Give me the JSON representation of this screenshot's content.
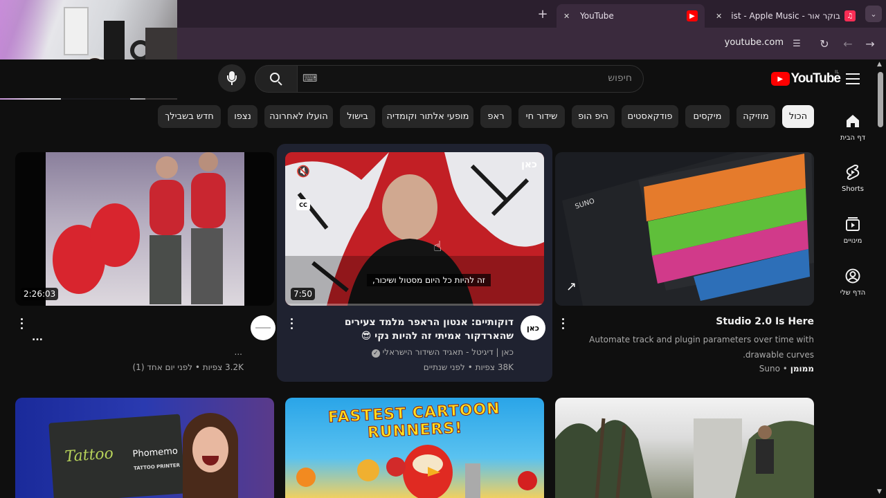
{
  "browser": {
    "tabs": [
      {
        "title": "YouTube"
      },
      {
        "title": "בוקר אור - Playlist - Apple Music"
      }
    ],
    "new_tab": "+",
    "url": "youtube.com"
  },
  "youtube": {
    "logo_text": "YouTube",
    "region": "IL",
    "search_placeholder": "חיפוש",
    "keyboard_glyph": "⌨"
  },
  "chips": [
    "הכול",
    "מוזיקה",
    "מיקסים",
    "פודקאסטים",
    "היפ הופ",
    "שידור חי",
    "ראפ",
    "מופעי אלתור וקומדיה",
    "בישול",
    "הועלו לאחרונה",
    "נצפו",
    "חדש בשבילך"
  ],
  "sidebar": [
    {
      "label": "דף הבית",
      "icon": "home-icon"
    },
    {
      "label": "Shorts",
      "icon": "shorts-icon"
    },
    {
      "label": "מינויים",
      "icon": "subscriptions-icon"
    },
    {
      "label": "הדף שלי",
      "icon": "account-icon"
    }
  ],
  "videos": [
    {
      "title": "Studio 2.0 Is Here",
      "description": "Automate track and plugin parameters over time with drawable curves.",
      "sponsored": "ממומן",
      "channel": "Suno",
      "bullet": "•"
    },
    {
      "title": "דוקותיים: אנטון הראפר מלמד צעירים שהארדקור אמיתי זה להיות נקי 😎",
      "channel": "כאן | דיגיטל - תאגיד השידור הישראלי",
      "meta": "38K צפיות • לפני שנתיים",
      "duration": "7:50",
      "caption": "זה להיות כל היום מסטול ושיכור,",
      "cc": "CC",
      "kan_logo": "כאן",
      "avatar_text": "כאן"
    },
    {
      "title": "...",
      "subtitle": "...",
      "meta": "3.2K צפיות • לפני יום אחד (1)",
      "duration": "2:26:03"
    }
  ],
  "row2": [
    {
      "banner": "FASTEST CARTOON RUNNERS!"
    },
    {
      "brand": "Tattoo",
      "product": "Phomemo",
      "product_sub": "TATTOO PRINTER"
    }
  ],
  "colors": {
    "background": "#0f0f0f",
    "chip": "#272727",
    "chip_active": "#f1f1f1",
    "youtube_red": "#ff0000",
    "secondary_text": "#aaaaaa"
  }
}
